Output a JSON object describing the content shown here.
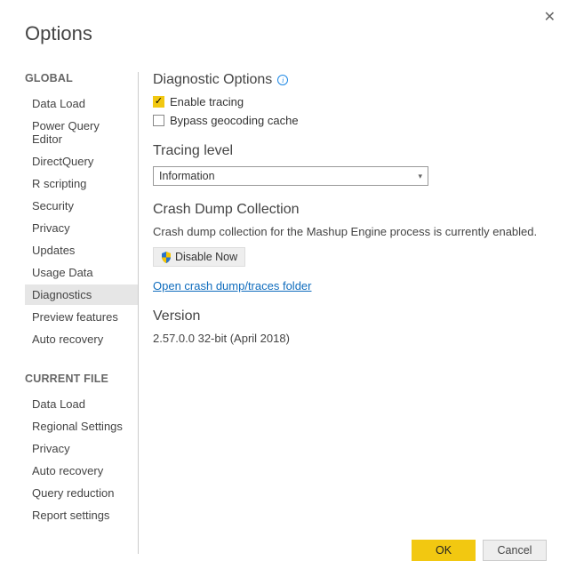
{
  "window": {
    "title": "Options"
  },
  "sidebar": {
    "sections": [
      {
        "label": "GLOBAL",
        "items": [
          {
            "label": "Data Load",
            "selected": false
          },
          {
            "label": "Power Query Editor",
            "selected": false
          },
          {
            "label": "DirectQuery",
            "selected": false
          },
          {
            "label": "R scripting",
            "selected": false
          },
          {
            "label": "Security",
            "selected": false
          },
          {
            "label": "Privacy",
            "selected": false
          },
          {
            "label": "Updates",
            "selected": false
          },
          {
            "label": "Usage Data",
            "selected": false
          },
          {
            "label": "Diagnostics",
            "selected": true
          },
          {
            "label": "Preview features",
            "selected": false
          },
          {
            "label": "Auto recovery",
            "selected": false
          }
        ]
      },
      {
        "label": "CURRENT FILE",
        "items": [
          {
            "label": "Data Load",
            "selected": false
          },
          {
            "label": "Regional Settings",
            "selected": false
          },
          {
            "label": "Privacy",
            "selected": false
          },
          {
            "label": "Auto recovery",
            "selected": false
          },
          {
            "label": "Query reduction",
            "selected": false
          },
          {
            "label": "Report settings",
            "selected": false
          }
        ]
      }
    ]
  },
  "content": {
    "diagnostic": {
      "heading": "Diagnostic Options",
      "enable_tracing_label": "Enable tracing",
      "enable_tracing_checked": true,
      "bypass_geocoding_label": "Bypass geocoding cache",
      "bypass_geocoding_checked": false
    },
    "tracing": {
      "heading": "Tracing level",
      "value": "Information"
    },
    "crash": {
      "heading": "Crash Dump Collection",
      "text": "Crash dump collection for the Mashup Engine process is currently enabled.",
      "disable_label": "Disable Now",
      "link": "Open crash dump/traces folder"
    },
    "version": {
      "heading": "Version",
      "value": "2.57.0.0 32-bit (April 2018)"
    }
  },
  "footer": {
    "ok": "OK",
    "cancel": "Cancel"
  }
}
